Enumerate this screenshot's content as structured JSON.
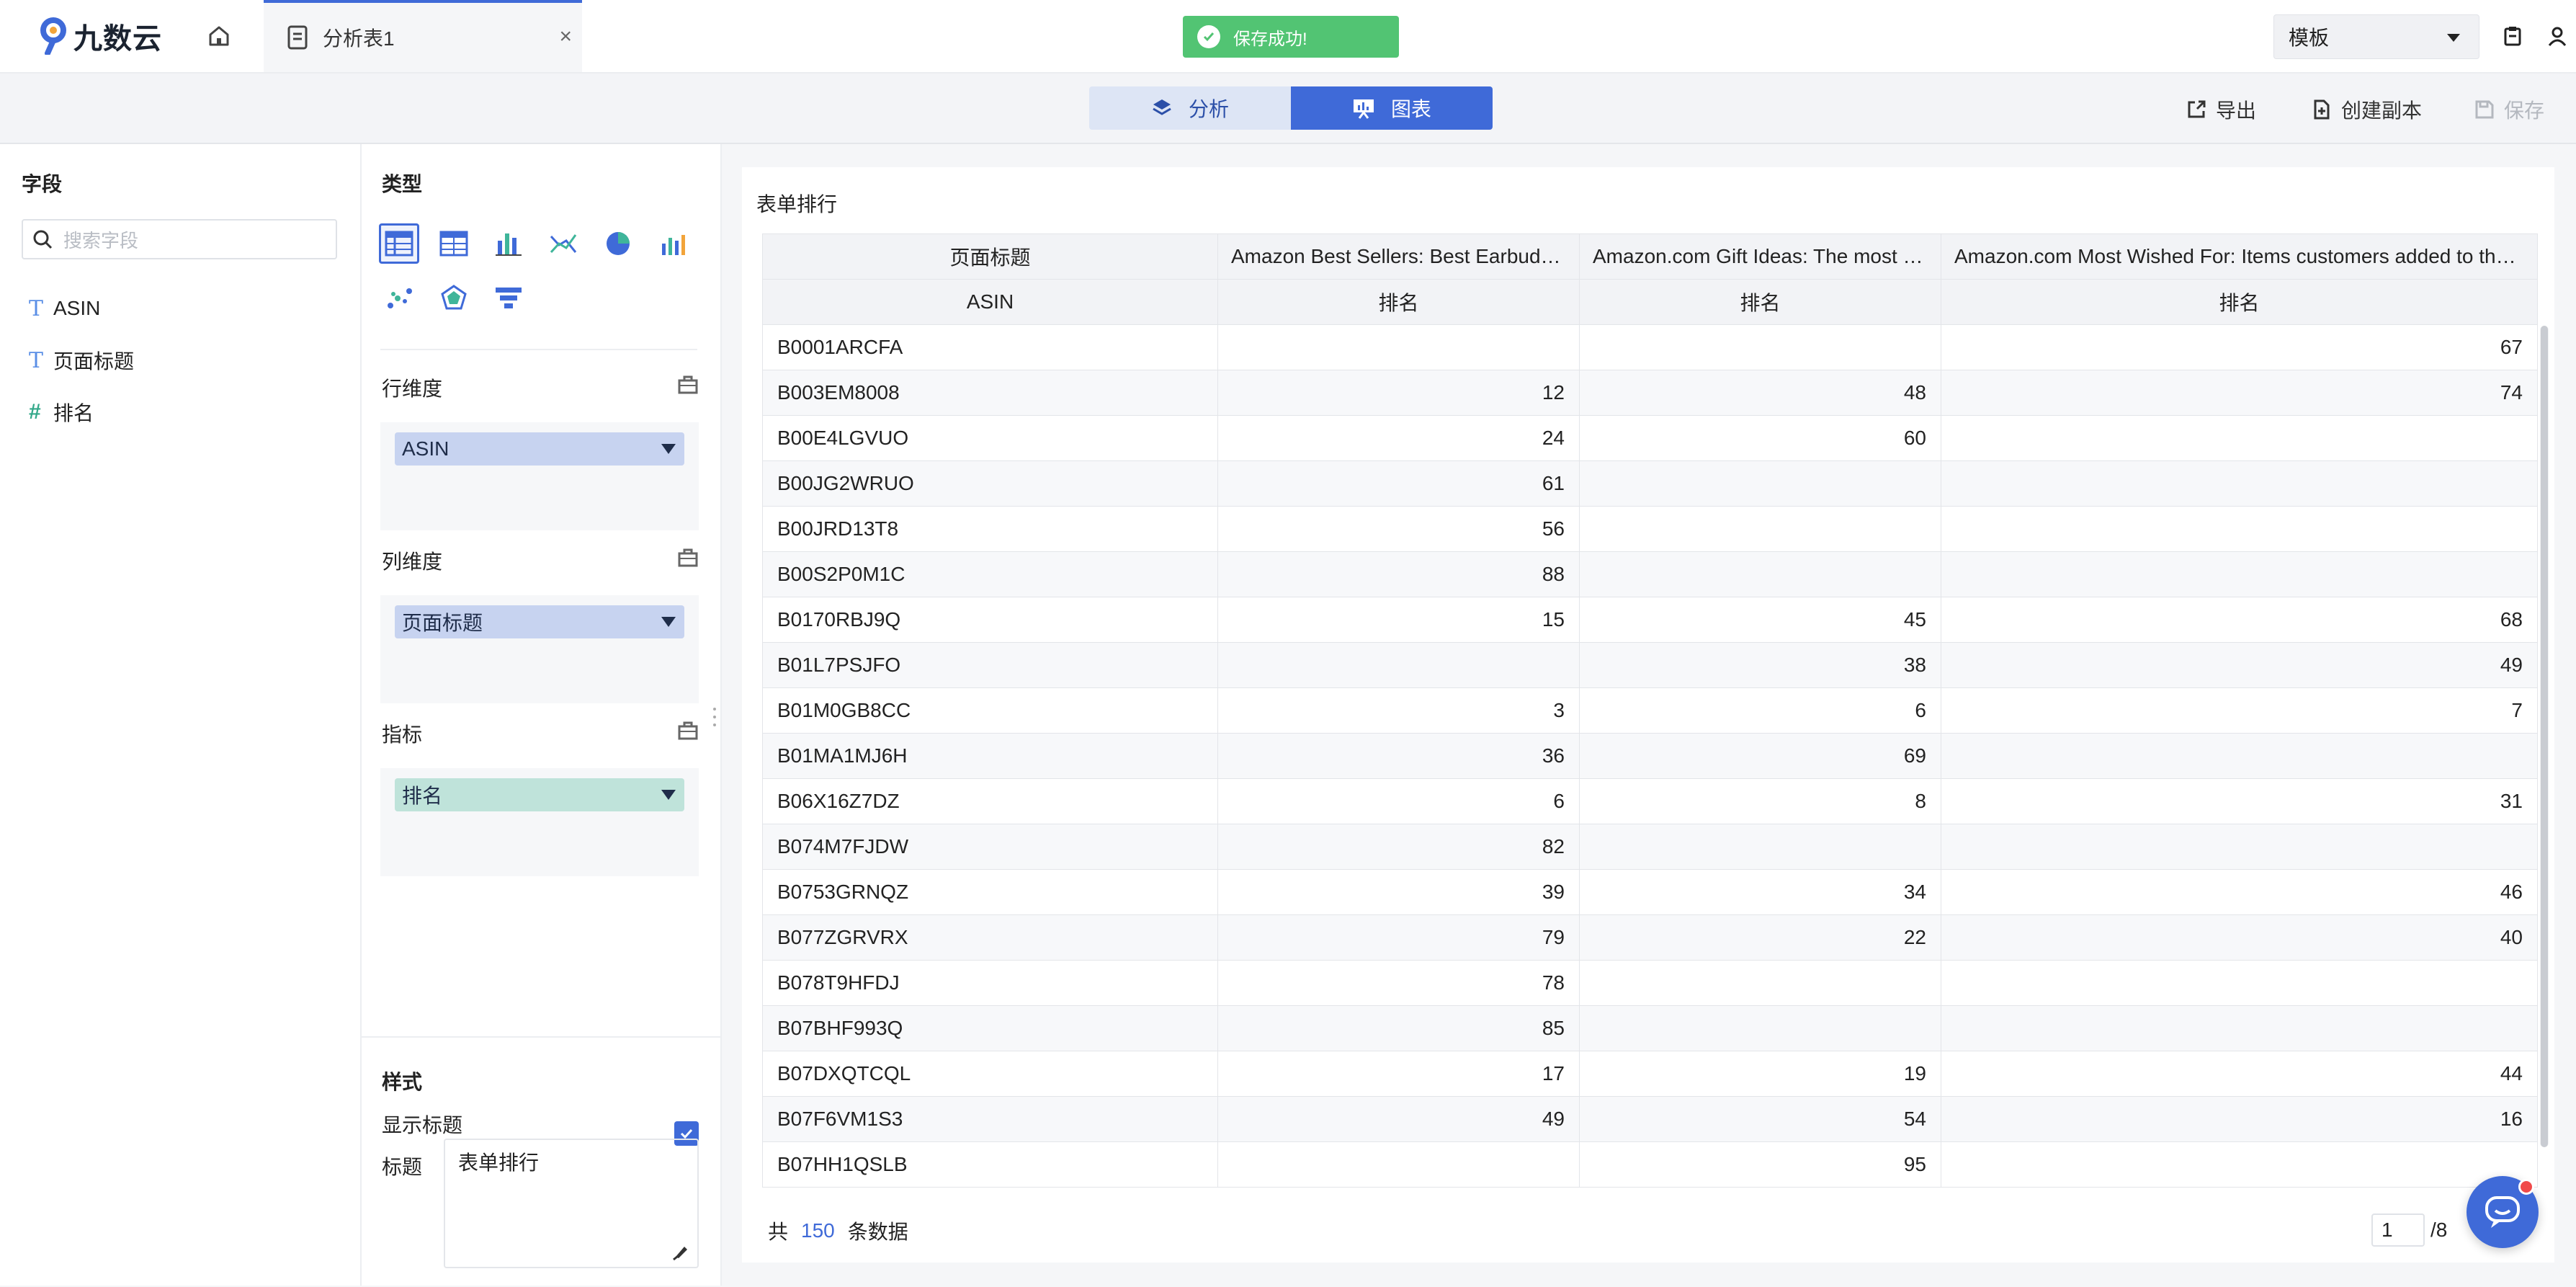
{
  "app": {
    "logo_text": "九数云"
  },
  "tab": {
    "title": "分析表1",
    "close": "×"
  },
  "toast": {
    "message": "保存成功!"
  },
  "template_select": {
    "value": "模板"
  },
  "view_toggle": {
    "analysis": "分析",
    "chart": "图表",
    "active": "chart"
  },
  "actions": {
    "export": "导出",
    "duplicate": "创建副本",
    "save": "保存"
  },
  "fields_panel": {
    "title": "字段",
    "search_placeholder": "搜索字段",
    "fields": [
      {
        "name": "ASIN",
        "type_icon": "T"
      },
      {
        "name": "页面标题",
        "type_icon": "T"
      },
      {
        "name": "排名",
        "type_icon": "#"
      }
    ]
  },
  "config_panel": {
    "type_title": "类型",
    "row_dim_title": "行维度",
    "row_dim_pill": "ASIN",
    "col_dim_title": "列维度",
    "col_dim_pill": "页面标题",
    "metric_title": "指标",
    "metric_pill": "排名",
    "style_title": "样式",
    "show_title_label": "显示标题",
    "show_title_checked": true,
    "title_label": "标题",
    "title_value": "表单排行"
  },
  "table": {
    "title": "表单排行",
    "header_row1": [
      "页面标题",
      "Amazon Best Sellers: Best Earbud Headphones",
      "Amazon.com Gift Ideas: The most gifted items",
      "Amazon.com Most Wished For: Items customers added to their lists"
    ],
    "header_row2": [
      "ASIN",
      "排名",
      "排名",
      "排名"
    ],
    "rows": [
      [
        "B0001ARCFA",
        "",
        "",
        "67"
      ],
      [
        "B003EM8008",
        "12",
        "48",
        "74"
      ],
      [
        "B00E4LGVUO",
        "24",
        "60",
        ""
      ],
      [
        "B00JG2WRUO",
        "61",
        "",
        ""
      ],
      [
        "B00JRD13T8",
        "56",
        "",
        ""
      ],
      [
        "B00S2P0M1C",
        "88",
        "",
        ""
      ],
      [
        "B0170RBJ9Q",
        "15",
        "45",
        "68"
      ],
      [
        "B01L7PSJFO",
        "",
        "38",
        "49"
      ],
      [
        "B01M0GB8CC",
        "3",
        "6",
        "7"
      ],
      [
        "B01MA1MJ6H",
        "36",
        "69",
        ""
      ],
      [
        "B06X16Z7DZ",
        "6",
        "8",
        "31"
      ],
      [
        "B074M7FJDW",
        "82",
        "",
        ""
      ],
      [
        "B0753GRNQZ",
        "39",
        "34",
        "46"
      ],
      [
        "B077ZGRVRX",
        "79",
        "22",
        "40"
      ],
      [
        "B078T9HFDJ",
        "78",
        "",
        ""
      ],
      [
        "B07BHF993Q",
        "85",
        "",
        ""
      ],
      [
        "B07DXQTCQL",
        "17",
        "19",
        "44"
      ],
      [
        "B07F6VM1S3",
        "49",
        "54",
        "16"
      ],
      [
        "B07HH1QSLB",
        "",
        "95",
        ""
      ]
    ],
    "footer_prefix": "共",
    "total_count": "150",
    "footer_suffix": "条数据",
    "current_page": "1",
    "total_pages": "/8"
  },
  "colors": {
    "accent": "#3f6ad8",
    "toast_green": "#52c473",
    "pill_blue": "#c7d3f0",
    "pill_green": "#bfe3da"
  }
}
